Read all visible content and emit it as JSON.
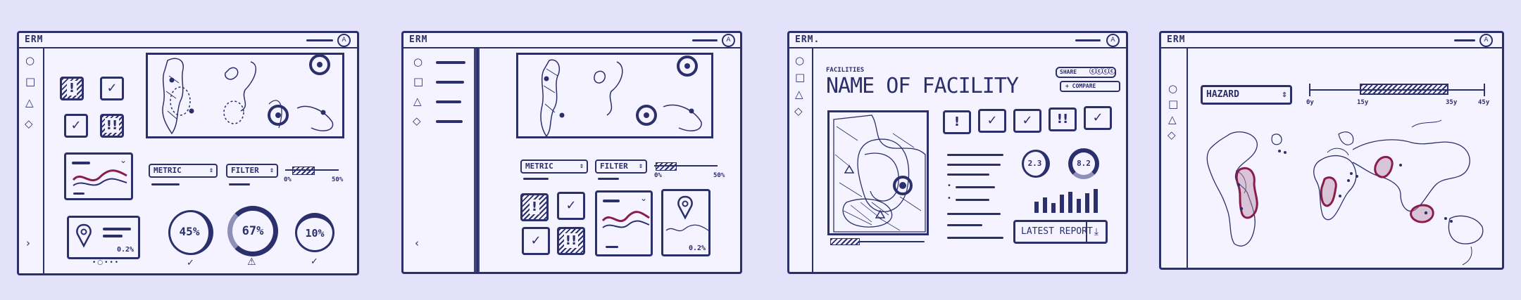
{
  "colors": {
    "background": "#e4e1fa",
    "ink": "#2b2f6b",
    "accent": "#8a1c4c",
    "paper": "#f4f3ff"
  },
  "frame1": {
    "logo": "ERM",
    "sidebar_icons": [
      "circle-icon",
      "square-icon",
      "triangle-icon",
      "diamond-icon",
      "chevron-right-icon"
    ],
    "tiles": [
      "!",
      "✓",
      "✓",
      "!!"
    ],
    "metric_select": "METRIC",
    "filter_select": "FILTER",
    "slider_min": "0%",
    "slider_max": "50%",
    "location_value": "0.2%",
    "gauges": [
      {
        "value": "45%",
        "status": "✓"
      },
      {
        "value": "67%",
        "status": "⚠"
      },
      {
        "value": "10%",
        "status": "✓"
      }
    ]
  },
  "frame2": {
    "logo": "ERM",
    "metric_select": "METRIC",
    "filter_select": "FILTER",
    "slider_min": "0%",
    "slider_max": "50%",
    "tiles": [
      "!",
      "✓",
      "✓",
      "!!"
    ],
    "location_value": "0.2%"
  },
  "frame3": {
    "logo": "ERM.",
    "breadcrumb": "FACILITIES",
    "title": "NAME OF FACILITY",
    "share_button": "SHARE",
    "compare_button": "+ COMPARE",
    "status_tiles": [
      "!",
      "✓",
      "✓",
      "!!",
      "✓"
    ],
    "gauge_values": [
      "2.3",
      "8.2"
    ],
    "report_button": "LATEST REPORT"
  },
  "frame4": {
    "logo": "ERM",
    "hazard_select": "HAZARD",
    "timeline_labels": [
      "0y",
      "15y",
      "35y",
      "45y"
    ]
  }
}
